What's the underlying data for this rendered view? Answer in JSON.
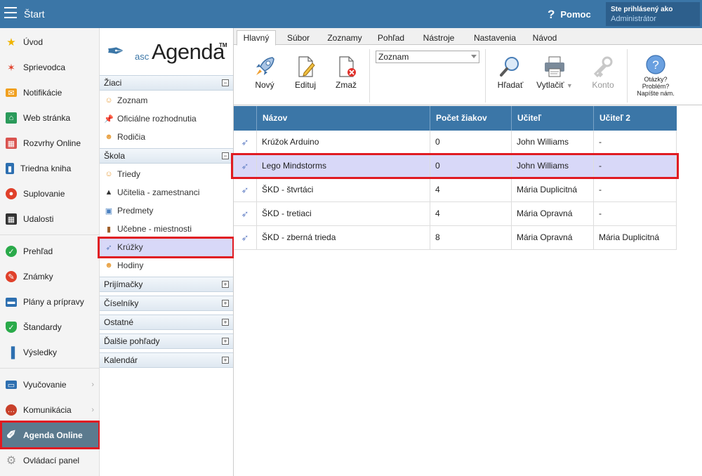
{
  "topbar": {
    "start_label": "Štart",
    "help_label": "Pomoc",
    "user_line1": "Ste prihlásený ako",
    "user_line2": "Administrátor"
  },
  "sidebar": {
    "items": [
      {
        "label": "Úvod",
        "icon": "star-icon"
      },
      {
        "label": "Sprievodca",
        "icon": "magic-wand-icon"
      },
      {
        "label": "Notifikácie",
        "icon": "envelope-icon"
      },
      {
        "label": "Web stránka",
        "icon": "house-icon"
      },
      {
        "label": "Rozvrhy Online",
        "icon": "calendar-grid-icon"
      },
      {
        "label": "Triedna kniha",
        "icon": "book-icon"
      },
      {
        "label": "Suplovanie",
        "icon": "person-icon"
      },
      {
        "label": "Udalosti",
        "icon": "calendar-icon"
      },
      {
        "label": "Prehľad",
        "icon": "check-circle-icon"
      },
      {
        "label": "Známky",
        "icon": "grade-circle-icon"
      },
      {
        "label": "Plány a prípravy",
        "icon": "briefcase-icon"
      },
      {
        "label": "Štandardy",
        "icon": "shield-check-icon"
      },
      {
        "label": "Výsledky",
        "icon": "bar-chart-icon"
      },
      {
        "label": "Vyučovanie",
        "icon": "open-book-icon"
      },
      {
        "label": "Komunikácia",
        "icon": "chat-bubbles-icon"
      },
      {
        "label": "Agenda Online",
        "icon": "agenda-feather-icon"
      },
      {
        "label": "Ovládací panel",
        "icon": "gear-icon"
      }
    ]
  },
  "logo": {
    "prefix": "asc",
    "name": "Agenda",
    "tm": "TM"
  },
  "midnav": {
    "groups": {
      "ziaci": "Žiaci",
      "skola": "Škola",
      "prijimacky": "Prijímačky",
      "ciselniky": "Číselníky",
      "ostatne": "Ostatné",
      "dalsie": "Ďalšie pohľady",
      "kalendar": "Kalendár"
    },
    "ziaci_items": [
      "Zoznam",
      "Oficiálne rozhodnutia",
      "Rodičia"
    ],
    "skola_items": [
      "Triedy",
      "Učitelia - zamestnanci",
      "Predmety",
      "Učebne - miestnosti",
      "Krúžky",
      "Hodiny"
    ]
  },
  "ribbon": {
    "tabs": [
      "Hlavný",
      "Súbor",
      "Zoznamy",
      "Pohľad",
      "Nástroje",
      "Nastavenia",
      "Návod"
    ],
    "buttons": {
      "novy": "Nový",
      "edituj": "Edituj",
      "zmaz": "Zmaž",
      "hladat": "Hľadať",
      "vytlacit": "Vytlačiť",
      "konto": "Konto",
      "otazky_1": "Otázky?",
      "otazky_2": "Problém?",
      "otazky_3": "Napíšte nám."
    },
    "combo_value": "Zoznam"
  },
  "table": {
    "headers": [
      "Názov",
      "Počet žiakov",
      "Učiteľ",
      "Učiteľ 2"
    ],
    "rows": [
      {
        "name": "Krúžok Arduino",
        "count": "0",
        "teacher": "John Williams",
        "teacher2": "-"
      },
      {
        "name": "Lego Mindstorms",
        "count": "0",
        "teacher": "John Williams",
        "teacher2": "-"
      },
      {
        "name": "ŠKD - štvrtáci",
        "count": "4",
        "teacher": "Mária Duplicitná",
        "teacher2": "-"
      },
      {
        "name": "ŠKD - tretiaci",
        "count": "4",
        "teacher": "Mária Opravná",
        "teacher2": "-"
      },
      {
        "name": "ŠKD - zberná trieda",
        "count": "8",
        "teacher": "Mária Opravná",
        "teacher2": "Mária Duplicitná"
      }
    ]
  },
  "colors": {
    "topbar": "#3b76a7",
    "table_header": "#3b76a7",
    "selected_row": "#d8d8f8",
    "highlight_box": "#e01b22",
    "sidebar_active": "#5b7a8e"
  }
}
